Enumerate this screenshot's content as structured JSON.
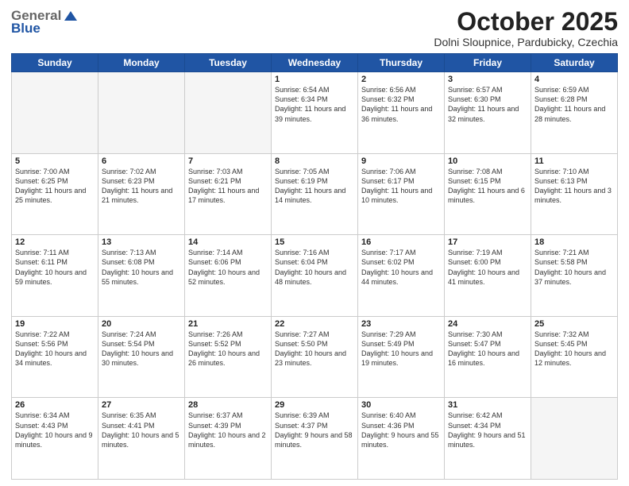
{
  "header": {
    "logo_general": "General",
    "logo_blue": "Blue",
    "month_title": "October 2025",
    "subtitle": "Dolni Sloupnice, Pardubicky, Czechia"
  },
  "weekdays": [
    "Sunday",
    "Monday",
    "Tuesday",
    "Wednesday",
    "Thursday",
    "Friday",
    "Saturday"
  ],
  "weeks": [
    [
      {
        "day": "",
        "info": ""
      },
      {
        "day": "",
        "info": ""
      },
      {
        "day": "",
        "info": ""
      },
      {
        "day": "1",
        "info": "Sunrise: 6:54 AM\nSunset: 6:34 PM\nDaylight: 11 hours and 39 minutes."
      },
      {
        "day": "2",
        "info": "Sunrise: 6:56 AM\nSunset: 6:32 PM\nDaylight: 11 hours and 36 minutes."
      },
      {
        "day": "3",
        "info": "Sunrise: 6:57 AM\nSunset: 6:30 PM\nDaylight: 11 hours and 32 minutes."
      },
      {
        "day": "4",
        "info": "Sunrise: 6:59 AM\nSunset: 6:28 PM\nDaylight: 11 hours and 28 minutes."
      }
    ],
    [
      {
        "day": "5",
        "info": "Sunrise: 7:00 AM\nSunset: 6:25 PM\nDaylight: 11 hours and 25 minutes."
      },
      {
        "day": "6",
        "info": "Sunrise: 7:02 AM\nSunset: 6:23 PM\nDaylight: 11 hours and 21 minutes."
      },
      {
        "day": "7",
        "info": "Sunrise: 7:03 AM\nSunset: 6:21 PM\nDaylight: 11 hours and 17 minutes."
      },
      {
        "day": "8",
        "info": "Sunrise: 7:05 AM\nSunset: 6:19 PM\nDaylight: 11 hours and 14 minutes."
      },
      {
        "day": "9",
        "info": "Sunrise: 7:06 AM\nSunset: 6:17 PM\nDaylight: 11 hours and 10 minutes."
      },
      {
        "day": "10",
        "info": "Sunrise: 7:08 AM\nSunset: 6:15 PM\nDaylight: 11 hours and 6 minutes."
      },
      {
        "day": "11",
        "info": "Sunrise: 7:10 AM\nSunset: 6:13 PM\nDaylight: 11 hours and 3 minutes."
      }
    ],
    [
      {
        "day": "12",
        "info": "Sunrise: 7:11 AM\nSunset: 6:11 PM\nDaylight: 10 hours and 59 minutes."
      },
      {
        "day": "13",
        "info": "Sunrise: 7:13 AM\nSunset: 6:08 PM\nDaylight: 10 hours and 55 minutes."
      },
      {
        "day": "14",
        "info": "Sunrise: 7:14 AM\nSunset: 6:06 PM\nDaylight: 10 hours and 52 minutes."
      },
      {
        "day": "15",
        "info": "Sunrise: 7:16 AM\nSunset: 6:04 PM\nDaylight: 10 hours and 48 minutes."
      },
      {
        "day": "16",
        "info": "Sunrise: 7:17 AM\nSunset: 6:02 PM\nDaylight: 10 hours and 44 minutes."
      },
      {
        "day": "17",
        "info": "Sunrise: 7:19 AM\nSunset: 6:00 PM\nDaylight: 10 hours and 41 minutes."
      },
      {
        "day": "18",
        "info": "Sunrise: 7:21 AM\nSunset: 5:58 PM\nDaylight: 10 hours and 37 minutes."
      }
    ],
    [
      {
        "day": "19",
        "info": "Sunrise: 7:22 AM\nSunset: 5:56 PM\nDaylight: 10 hours and 34 minutes."
      },
      {
        "day": "20",
        "info": "Sunrise: 7:24 AM\nSunset: 5:54 PM\nDaylight: 10 hours and 30 minutes."
      },
      {
        "day": "21",
        "info": "Sunrise: 7:26 AM\nSunset: 5:52 PM\nDaylight: 10 hours and 26 minutes."
      },
      {
        "day": "22",
        "info": "Sunrise: 7:27 AM\nSunset: 5:50 PM\nDaylight: 10 hours and 23 minutes."
      },
      {
        "day": "23",
        "info": "Sunrise: 7:29 AM\nSunset: 5:49 PM\nDaylight: 10 hours and 19 minutes."
      },
      {
        "day": "24",
        "info": "Sunrise: 7:30 AM\nSunset: 5:47 PM\nDaylight: 10 hours and 16 minutes."
      },
      {
        "day": "25",
        "info": "Sunrise: 7:32 AM\nSunset: 5:45 PM\nDaylight: 10 hours and 12 minutes."
      }
    ],
    [
      {
        "day": "26",
        "info": "Sunrise: 6:34 AM\nSunset: 4:43 PM\nDaylight: 10 hours and 9 minutes."
      },
      {
        "day": "27",
        "info": "Sunrise: 6:35 AM\nSunset: 4:41 PM\nDaylight: 10 hours and 5 minutes."
      },
      {
        "day": "28",
        "info": "Sunrise: 6:37 AM\nSunset: 4:39 PM\nDaylight: 10 hours and 2 minutes."
      },
      {
        "day": "29",
        "info": "Sunrise: 6:39 AM\nSunset: 4:37 PM\nDaylight: 9 hours and 58 minutes."
      },
      {
        "day": "30",
        "info": "Sunrise: 6:40 AM\nSunset: 4:36 PM\nDaylight: 9 hours and 55 minutes."
      },
      {
        "day": "31",
        "info": "Sunrise: 6:42 AM\nSunset: 4:34 PM\nDaylight: 9 hours and 51 minutes."
      },
      {
        "day": "",
        "info": ""
      }
    ]
  ]
}
